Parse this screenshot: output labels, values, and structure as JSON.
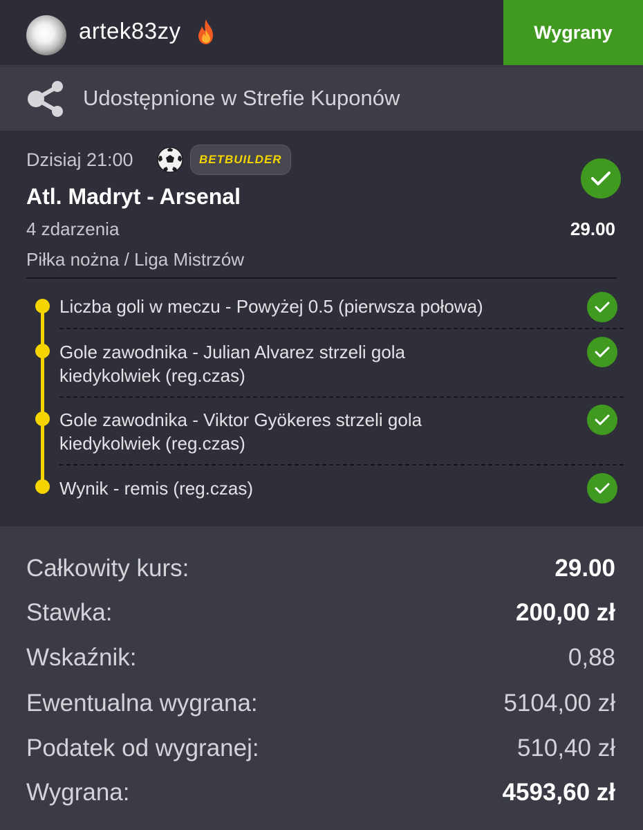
{
  "header": {
    "username": "artek83zy",
    "status_label": "Wygrany"
  },
  "shared": {
    "text": "Udostępnione w Strefie Kuponów"
  },
  "event": {
    "time": "Dzisiaj 21:00",
    "badge": "BETBUILDER",
    "match": "Atl. Madryt - Arsenal",
    "events_count": "4 zdarzenia",
    "odds": "29.00",
    "league": "Piłka nożna / Liga Mistrzów"
  },
  "selections": [
    {
      "line1": "Liczba goli w meczu - Powyżej 0.5 (pierwsza połowa)",
      "line2": ""
    },
    {
      "line1": "Gole zawodnika - Julian Alvarez strzeli gola",
      "line2": "kiedykolwiek  (reg.czas)"
    },
    {
      "line1": "Gole zawodnika - Viktor Gyökeres strzeli gola",
      "line2": "kiedykolwiek  (reg.czas)"
    },
    {
      "line1": "Wynik - remis (reg.czas)",
      "line2": ""
    }
  ],
  "summary": {
    "total_odds_label": "Całkowity kurs:",
    "total_odds_value": "29.00",
    "stake_label": "Stawka:",
    "stake_value": "200,00 zł",
    "factor_label": "Wskaźnik:",
    "factor_value": "0,88",
    "potential_label": "Ewentualna wygrana:",
    "potential_value": "5104,00 zł",
    "tax_label": "Podatek od wygranej:",
    "tax_value": "510,40 zł",
    "win_label": "Wygrana:",
    "win_value": "4593,60 zł"
  },
  "colors": {
    "win_green": "#3f9a1f",
    "accent_yellow": "#f5d400",
    "background": "#2e2f39",
    "panel": "#3a3b45"
  },
  "icons": [
    "avatar",
    "fire-icon",
    "share-icon",
    "soccer-ball-icon",
    "check-icon"
  ]
}
